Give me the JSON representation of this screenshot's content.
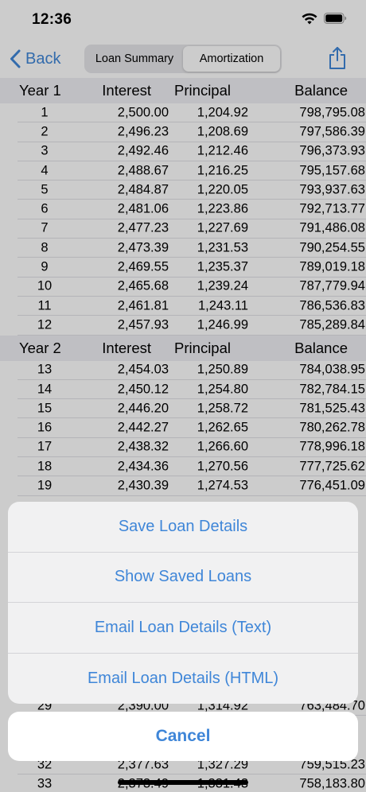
{
  "status_bar": {
    "time": "12:36"
  },
  "nav": {
    "back_label": "Back",
    "segments": [
      "Loan Summary",
      "Amortization"
    ],
    "active_segment": 1
  },
  "columns": {
    "interest": "Interest",
    "principal": "Principal",
    "balance": "Balance"
  },
  "years": [
    {
      "label": "Year 1",
      "rows": [
        [
          "1",
          "2,500.00",
          "1,204.92",
          "798,795.08"
        ],
        [
          "2",
          "2,496.23",
          "1,208.69",
          "797,586.39"
        ],
        [
          "3",
          "2,492.46",
          "1,212.46",
          "796,373.93"
        ],
        [
          "4",
          "2,488.67",
          "1,216.25",
          "795,157.68"
        ],
        [
          "5",
          "2,484.87",
          "1,220.05",
          "793,937.63"
        ],
        [
          "6",
          "2,481.06",
          "1,223.86",
          "792,713.77"
        ],
        [
          "7",
          "2,477.23",
          "1,227.69",
          "791,486.08"
        ],
        [
          "8",
          "2,473.39",
          "1,231.53",
          "790,254.55"
        ],
        [
          "9",
          "2,469.55",
          "1,235.37",
          "789,019.18"
        ],
        [
          "10",
          "2,465.68",
          "1,239.24",
          "787,779.94"
        ],
        [
          "11",
          "2,461.81",
          "1,243.11",
          "786,536.83"
        ],
        [
          "12",
          "2,457.93",
          "1,246.99",
          "785,289.84"
        ]
      ]
    },
    {
      "label": "Year 2",
      "rows": [
        [
          "13",
          "2,454.03",
          "1,250.89",
          "784,038.95"
        ],
        [
          "14",
          "2,450.12",
          "1,254.80",
          "782,784.15"
        ],
        [
          "15",
          "2,446.20",
          "1,258.72",
          "781,525.43"
        ],
        [
          "16",
          "2,442.27",
          "1,262.65",
          "780,262.78"
        ],
        [
          "17",
          "2,438.32",
          "1,266.60",
          "778,996.18"
        ],
        [
          "18",
          "2,434.36",
          "1,270.56",
          "777,725.62"
        ],
        [
          "19",
          "2,430.39",
          "1,274.53",
          "776,451.09"
        ]
      ]
    }
  ],
  "peek_rows": [
    [
      "29",
      "2,390.00",
      "1,314.92",
      "763,484.70"
    ],
    [
      "32",
      "2,377.63",
      "1,327.29",
      "759,515.23"
    ],
    [
      "33",
      "2,373.49",
      "1,331.43",
      "758,183.80"
    ]
  ],
  "action_sheet": {
    "items": [
      "Save Loan Details",
      "Show Saved Loans",
      "Email Loan Details (Text)",
      "Email Loan Details (HTML)"
    ],
    "cancel": "Cancel",
    "accent_color": "#3f86d8"
  }
}
